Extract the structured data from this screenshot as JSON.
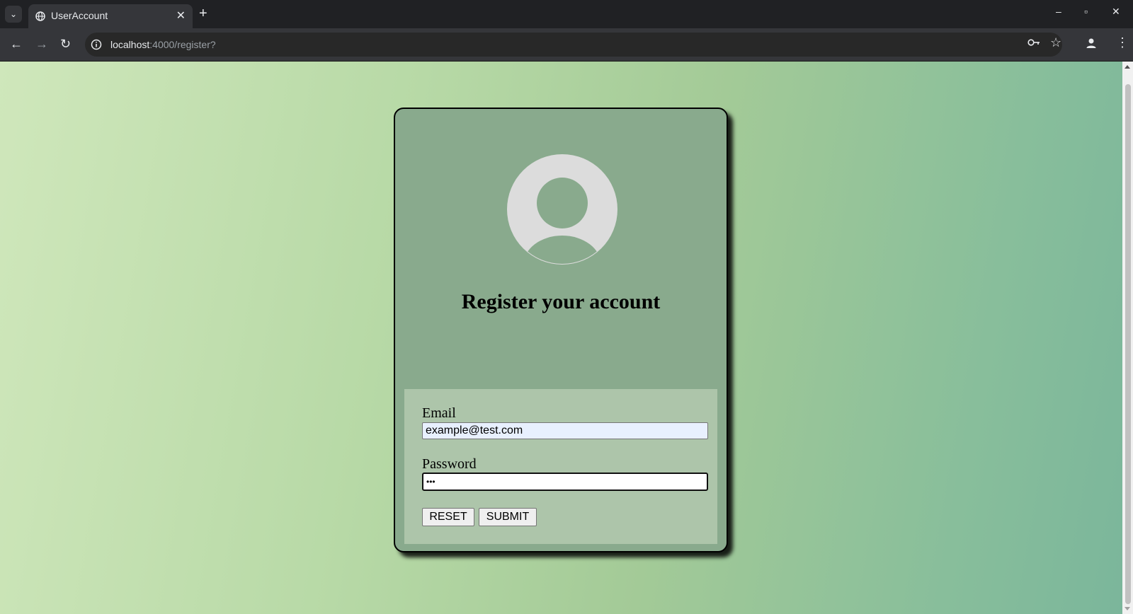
{
  "browser": {
    "tab_title": "UserAccount",
    "url_host": "localhost",
    "url_path": ":4000/register?"
  },
  "icons": {
    "tab_list": "chevron-down-icon",
    "tab_favicon": "globe-icon",
    "tab_close": "close-icon",
    "new_tab": "plus-icon",
    "minimize": "minimize-icon",
    "maximize": "maximize-icon",
    "close_window": "close-icon",
    "back": "arrow-left-icon",
    "forward": "arrow-right-icon",
    "reload": "reload-icon",
    "site_info": "info-icon",
    "password_key": "key-icon",
    "bookmark": "star-icon",
    "profile": "person-icon",
    "menu": "kebab-menu-icon",
    "avatar": "user-avatar-icon"
  },
  "page": {
    "heading": "Register your account",
    "form": {
      "email_label": "Email",
      "email_value": "example@test.com",
      "password_label": "Password",
      "password_value": "abc",
      "reset_label": "RESET",
      "submit_label": "SUBMIT"
    }
  },
  "colors": {
    "card_bg": "#89aa8d",
    "form_panel_bg": "#adc5aa",
    "autofill_bg": "#e8f0fe"
  }
}
